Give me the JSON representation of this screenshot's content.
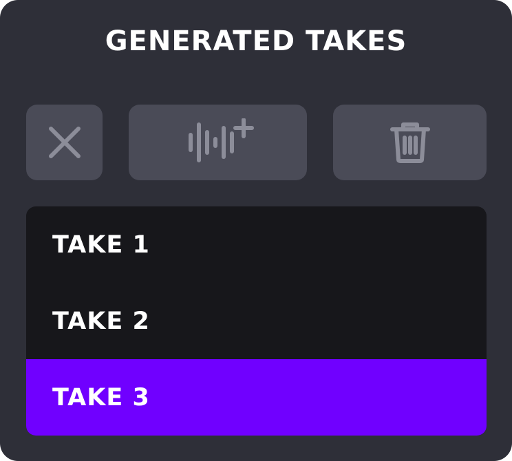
{
  "header": {
    "title": "GENERATED TAKES"
  },
  "toolbar": {
    "buttons": [
      {
        "icon": "close-icon"
      },
      {
        "icon": "waveform-add-icon"
      },
      {
        "icon": "trash-icon"
      }
    ]
  },
  "takes": {
    "items": [
      {
        "label": "TAKE 1"
      },
      {
        "label": "TAKE 2"
      },
      {
        "label": "TAKE 3"
      }
    ],
    "selected_index": 2
  },
  "colors": {
    "panel_bg": "#2e2f38",
    "button_bg": "#4a4b57",
    "icon": "#8c8d99",
    "list_bg": "#17171b",
    "selected_accent": "#7000ff"
  }
}
